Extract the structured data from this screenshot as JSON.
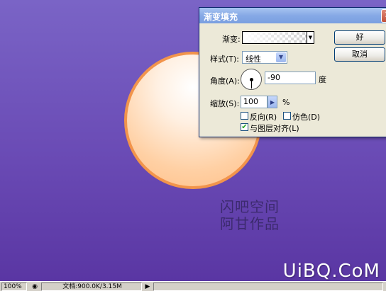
{
  "canvas": {
    "text_line1": "闪吧空间",
    "text_line2": "阿甘作品",
    "watermark": "UiBQ.CoM",
    "background_color": "#6a4bb5",
    "circle_stroke": "#f2944b"
  },
  "dialog": {
    "title": "渐变填充",
    "close_glyph": "✕",
    "gradient_label": "渐变:",
    "style_label": "样式(T):",
    "style_value": "线性",
    "angle_label": "角度(A):",
    "angle_value": "-90",
    "angle_unit": "度",
    "scale_label": "缩放(S):",
    "scale_value": "100",
    "scale_unit": "%",
    "reverse_label": "反向(R)",
    "dither_label": "仿色(D)",
    "align_label": "与图层对齐(L)",
    "reverse_checked": false,
    "dither_checked": false,
    "align_checked": true,
    "ok_label": "好",
    "cancel_label": "取消"
  },
  "statusbar": {
    "zoom": "100%",
    "doc_info": "文档:900.0K/3.15M",
    "arrow_glyph": "▶"
  }
}
